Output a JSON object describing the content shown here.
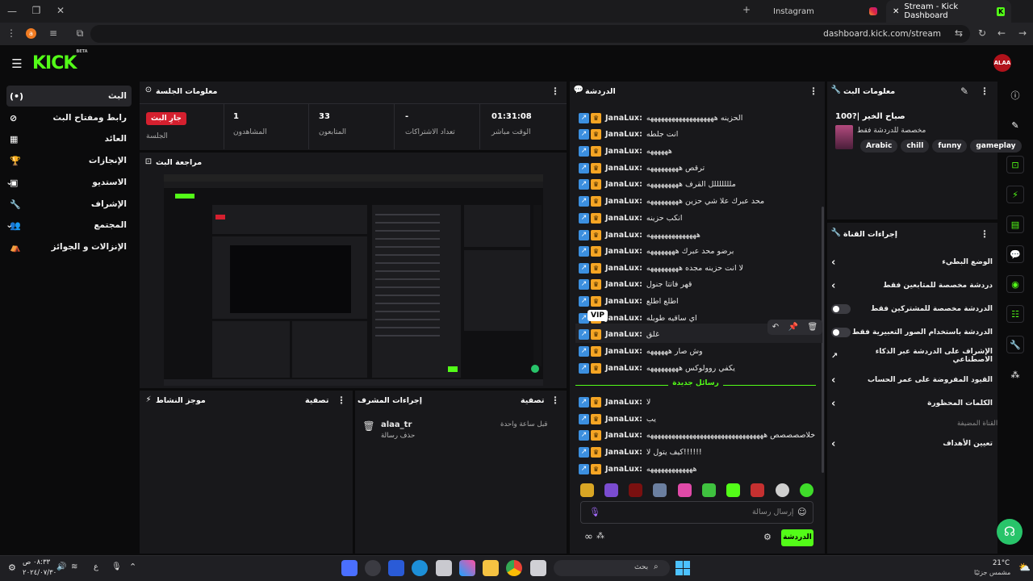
{
  "browser": {
    "tabs": [
      {
        "label": "Instagram"
      },
      {
        "label": "Stream - Kick Dashboard"
      }
    ],
    "url": "dashboard.kick.com/stream",
    "profile_initial": "a"
  },
  "header": {
    "logo": "KICK",
    "logo_badge": "BETA",
    "user_avatar_text": "ALAA"
  },
  "nav": {
    "items": [
      {
        "label": "البث",
        "icon": "(•)"
      },
      {
        "label": "رابط ومفتاح البث",
        "icon": "⊘"
      },
      {
        "label": "العائد",
        "icon": "▦"
      },
      {
        "label": "الإنجازات",
        "icon": "🏆"
      },
      {
        "label": "الاستديو",
        "icon": "▣"
      },
      {
        "label": "الإشراف",
        "icon": "🔧"
      },
      {
        "label": "المجتمع",
        "icon": "👥"
      },
      {
        "label": "الإنزالات و الجوائز",
        "icon": "⛺"
      }
    ]
  },
  "session": {
    "title": "معلومات الجلسة",
    "live_badge": "جارِ البث",
    "session_label": "الجلسة",
    "stats": [
      {
        "value": "1",
        "label": "المشاهدون"
      },
      {
        "value": "33",
        "label": "المتابعون"
      },
      {
        "value": "-",
        "label": "تعداد الاشتراكات"
      },
      {
        "value": "01:31:08",
        "label": "الوقت مباشر"
      }
    ]
  },
  "preview": {
    "title": "مراجعة البث"
  },
  "activity": {
    "title": "موجز النشاط",
    "filter": "تصفية"
  },
  "modactions": {
    "title": "إجراءات المشرف",
    "filter": "تصفية",
    "entry_user": "alaa_tr",
    "entry_action": "حذف رسالة",
    "entry_time": "قبل ساعة واحدة"
  },
  "chat": {
    "title": "الدردشة",
    "messages": [
      {
        "user": "JanaLux:",
        "text": "الحزينه هههههههههههههههههههه"
      },
      {
        "user": "JanaLux:",
        "text": "انت جلطه"
      },
      {
        "user": "JanaLux:",
        "text": "ههههههه"
      },
      {
        "user": "JanaLux:",
        "text": "ترقص هههههههههه"
      },
      {
        "user": "JanaLux:",
        "text": "ملللللللل القرف هههههههههه"
      },
      {
        "user": "JanaLux:",
        "text": "محد عبرك علا شي حزين هههههههههه"
      },
      {
        "user": "JanaLux:",
        "text": "انكب حزينه"
      },
      {
        "user": "JanaLux:",
        "text": "ههههههههههههههه"
      },
      {
        "user": "JanaLux:",
        "text": "برضو محد عبرك ههههههههه"
      },
      {
        "user": "JanaLux:",
        "text": "لا انت حزينه مجده هههههههههه"
      },
      {
        "user": "JanaLux:",
        "text": "قهر فاتتا جنول"
      },
      {
        "user": "JanaLux:",
        "text": "اطلع اطلع"
      },
      {
        "user": "JanaLux:",
        "text": "اي ساقيه طويله"
      },
      {
        "user": "JanaLux:",
        "text": "غلق"
      },
      {
        "user": "JanaLux:",
        "text": "وش صار ههههههه"
      },
      {
        "user": "JanaLux:",
        "text": "يكفي روولوكس هههههههههه"
      }
    ],
    "new_messages_label": "رسائل جديدة",
    "new_messages": [
      {
        "user": "JanaLux:",
        "text": "لا"
      },
      {
        "user": "JanaLux:",
        "text": "يب"
      },
      {
        "user": "JanaLux:",
        "text": "خلاصصصصص هههههههههههههههههههههههههههههههههه"
      },
      {
        "user": "JanaLux:",
        "text": "كيف يتول لا!!!!!!"
      },
      {
        "user": "JanaLux:",
        "text": "هههههههههههههه"
      }
    ],
    "vip_tooltip": "VIP",
    "input_placeholder": "إرسال رسالة",
    "send_button": "الدردشة"
  },
  "stream_info": {
    "title": "معلومات البث",
    "stream_title": "صباح الخير |?100",
    "category": "مخصصة للدردشة فقط",
    "tags": [
      "Arabic",
      "chill",
      "funny",
      "gameplay"
    ]
  },
  "channel_actions": {
    "title": "إجراءات القناة",
    "items": [
      {
        "label": "الوضع البطيء",
        "control": "chevron"
      },
      {
        "label": "دردشة مخصصة للمتابعين فقط",
        "control": "chevron"
      },
      {
        "label": "الدردشة مخصصة للمشتركين فقط",
        "control": "toggle"
      },
      {
        "label": "الدردشة باستخدام الصور التعبيرية فقط",
        "control": "toggle"
      },
      {
        "label": "الإشراف على الدردشة عبر الذكاء الاصطناعي",
        "control": "external"
      },
      {
        "label": "القيود المفروضة على عمر الحساب",
        "control": "chevron"
      },
      {
        "label": "الكلمات المحظورة",
        "control": "chevron"
      }
    ],
    "section_label": "القناة المضيفة",
    "goals_label": "تعيين الأهداف"
  },
  "taskbar": {
    "time": "٠٨:٣٣ ص",
    "date": "٢٠٢٤/٠٧/٣٠",
    "lang": "ع",
    "search_placeholder": "بحث",
    "weather_temp": "21°C",
    "weather_desc": "مشمس جزئيًا"
  }
}
